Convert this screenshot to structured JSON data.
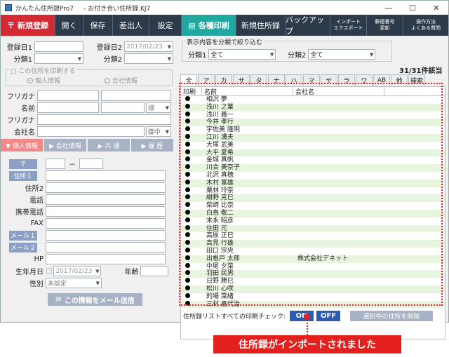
{
  "window": {
    "title_app": "かんたん住所録Pro7",
    "title_file": "- お付き合い住所録.KJ7",
    "minimize": "—",
    "maximize": "☐",
    "close": "✕"
  },
  "toolbar": {
    "new_register": "新規登録",
    "open": "開く",
    "save": "保存",
    "sender": "差出人",
    "settings": "設定",
    "print": "各種印刷",
    "new_book": "新規住所録",
    "backup": "バックアップ",
    "import_1": "インポート",
    "import_2": "エクスポート",
    "postal_1": "郵便番号",
    "postal_2": "更新",
    "help_1": "操作方法",
    "help_2": "よくある質問"
  },
  "form": {
    "reg_date1_label": "登録日1",
    "reg_date2_label": "登録日2",
    "reg_date2_value": "2017/02/23",
    "class1_label": "分類1",
    "class2_label": "分類2",
    "print_check_legend": "この住所を印刷する",
    "radio_personal": "個人情報",
    "radio_company": "会社情報",
    "furigana_label": "フリガナ",
    "name_label": "名前",
    "honorific_value": "様",
    "furigana2_label": "フリガナ",
    "company_label": "会社名",
    "company_honorific": "御中",
    "tab_personal": "▼ 個人情報",
    "tab_company": "▶ 会社情報",
    "tab_common": "▶ 共 通",
    "tab_history": "▶ 履 歴",
    "postal_btn": "〒",
    "postal_dash": "－",
    "address1_btn": "住所１",
    "address2_label": "住所2",
    "phone_label": "電話",
    "mobile_label": "携帯電話",
    "fax_label": "FAX",
    "mail1_btn": "メール１",
    "mail2_btn": "メール２",
    "hp_label": "HP",
    "birth_label": "生年月日",
    "birth_value": "2017/02/23",
    "age_label": "年齢",
    "gender_label": "性別",
    "gender_value": "未設定",
    "mail_send": "この情報をメール送信"
  },
  "filter": {
    "legend": "表示内容を分類で絞り込む",
    "class1_label": "分類1",
    "class1_value": "全て",
    "class2_label": "分類2",
    "class2_value": "全て",
    "count": "31/31件該当"
  },
  "alpha_tabs": [
    "全",
    "ア",
    "カ",
    "サ",
    "タ",
    "ナ",
    "ハ",
    "マ",
    "ヤ",
    "ラ",
    "ワ",
    "AB",
    "他",
    "検索"
  ],
  "list": {
    "col_print": "印刷",
    "col_name": "名前",
    "col_company": "会社名",
    "rows": [
      {
        "name": "相沢 夢",
        "company": ""
      },
      {
        "name": "浅川 之業",
        "company": ""
      },
      {
        "name": "浅川 義一",
        "company": ""
      },
      {
        "name": "今井 孝行",
        "company": ""
      },
      {
        "name": "宇佐美 隆明",
        "company": ""
      },
      {
        "name": "江川 満夫",
        "company": ""
      },
      {
        "name": "大塚 武美",
        "company": ""
      },
      {
        "name": "大平 夏希",
        "company": ""
      },
      {
        "name": "金城 真帆",
        "company": ""
      },
      {
        "name": "川合 美奈子",
        "company": ""
      },
      {
        "name": "北沢 真穂",
        "company": ""
      },
      {
        "name": "木村 富雄",
        "company": ""
      },
      {
        "name": "栗林 玲奈",
        "company": ""
      },
      {
        "name": "紺野 克巳",
        "company": ""
      },
      {
        "name": "柴崎 比奈",
        "company": ""
      },
      {
        "name": "白鳥 敬二",
        "company": ""
      },
      {
        "name": "末永 昭彦",
        "company": ""
      },
      {
        "name": "住田 元",
        "company": ""
      },
      {
        "name": "高原 正巳",
        "company": ""
      },
      {
        "name": "高見 行雄",
        "company": ""
      },
      {
        "name": "田口 宗央",
        "company": ""
      },
      {
        "name": "出根戸 太郎",
        "company": "株式会社デネット"
      },
      {
        "name": "中尾 夕菜",
        "company": ""
      },
      {
        "name": "羽田 民男",
        "company": ""
      },
      {
        "name": "日野 勝巳",
        "company": ""
      },
      {
        "name": "松川 心咲",
        "company": ""
      },
      {
        "name": "的場 菜緒",
        "company": ""
      },
      {
        "name": "三村 喜代治",
        "company": ""
      }
    ]
  },
  "bottom": {
    "label": "住所録リストすべての印刷チェック:",
    "on": "ON",
    "off": "OFF",
    "delete_selected": "選択中の住所を削除"
  },
  "callout": "住所録がインポートされました",
  "colors": {
    "toolbar_bg": "#2d3a4a",
    "new_btn": "#d42a33",
    "print_btn": "#1fa7a0",
    "on_btn": "#2c5bb4",
    "off_btn": "#2c5bb4",
    "highlight": "#e41f24"
  }
}
